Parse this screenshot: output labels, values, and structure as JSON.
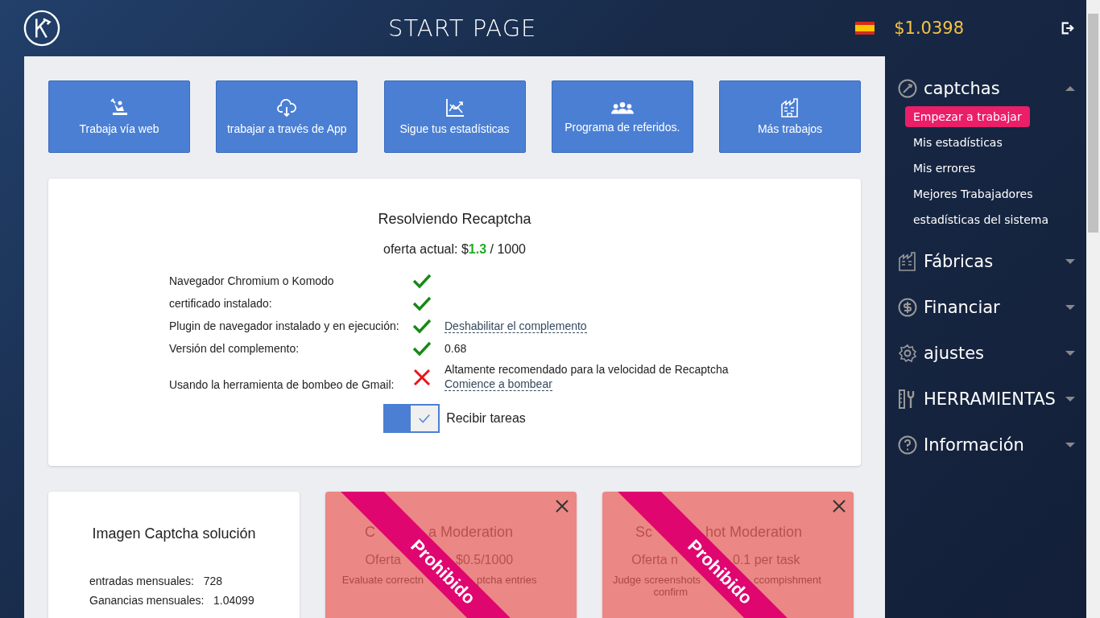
{
  "header": {
    "title": "START PAGE",
    "balance": "$1.0398"
  },
  "tiles": [
    {
      "kind": "worker",
      "label": "Trabaja vía web"
    },
    {
      "kind": "cloud",
      "label": "trabajar a través de App"
    },
    {
      "kind": "chart",
      "label": "Sigue tus estadísticas"
    },
    {
      "kind": "people",
      "label": "Programa de referidos."
    },
    {
      "kind": "factory",
      "label": "Más trabajos"
    }
  ],
  "recaptcha": {
    "title": "Resolviendo Recaptcha",
    "offer_label": "oferta actual: $",
    "offer_value": "1.3",
    "offer_unit": "/ 1000",
    "checks": [
      {
        "label": "Navegador Chromium o Komodo",
        "ok": true
      },
      {
        "label": "certificado instalado:",
        "ok": true
      },
      {
        "label": "Plugin de navegador instalado y en ejecución:",
        "ok": true,
        "link": "Deshabilitar el complemento"
      },
      {
        "label": "Versión del complemento:",
        "ok": true,
        "value": "0.68"
      },
      {
        "label": "Usando la herramienta de bombeo de Gmail:",
        "ok": false,
        "value": "Altamente recomendado para la velocidad de Recaptcha",
        "link": "Comience a bombear"
      }
    ],
    "toggle": {
      "label": "Recibir tareas",
      "on": true
    }
  },
  "image_card": {
    "title": "Imagen Captcha solución",
    "stats": [
      {
        "label": "entradas mensuales:",
        "value": "728"
      },
      {
        "label": "Ganancias mensuales:",
        "value": "1.04099"
      }
    ]
  },
  "banned_cards": [
    {
      "ribbon": "Prohibido",
      "rows": [
        [
          "C",
          "a Moderation"
        ],
        [
          "Oferta",
          "$0.5/1000"
        ],
        [
          "Evaluate correctn",
          "ptcha entries"
        ]
      ]
    },
    {
      "ribbon": "Prohibido",
      "rows": [
        [
          "Sc",
          "hot Moderation"
        ],
        [
          "Oferta n",
          "0.1 per task"
        ],
        [
          "Judge screenshots",
          "ccompishment"
        ],
        [
          "confirm",
          ""
        ]
      ]
    }
  ],
  "sidebar": [
    {
      "kind": "gauge",
      "label": "captchas",
      "expanded": true,
      "children": [
        {
          "label": "Empezar a trabajar",
          "selected": true
        },
        {
          "label": "Mis estadísticas",
          "selected": false
        },
        {
          "label": "Mis errores",
          "selected": false
        },
        {
          "label": "Mejores Trabajadores",
          "selected": false
        },
        {
          "label": "estadísticas del sistema",
          "selected": false
        }
      ]
    },
    {
      "kind": "factory",
      "label": "Fábricas",
      "expanded": false
    },
    {
      "kind": "dollar",
      "label": "Financiar",
      "expanded": false
    },
    {
      "kind": "gear",
      "label": "ajustes",
      "expanded": false
    },
    {
      "kind": "tools",
      "label": "HERRAMIENTAS",
      "expanded": false
    },
    {
      "kind": "question",
      "label": "Información",
      "expanded": false
    }
  ]
}
